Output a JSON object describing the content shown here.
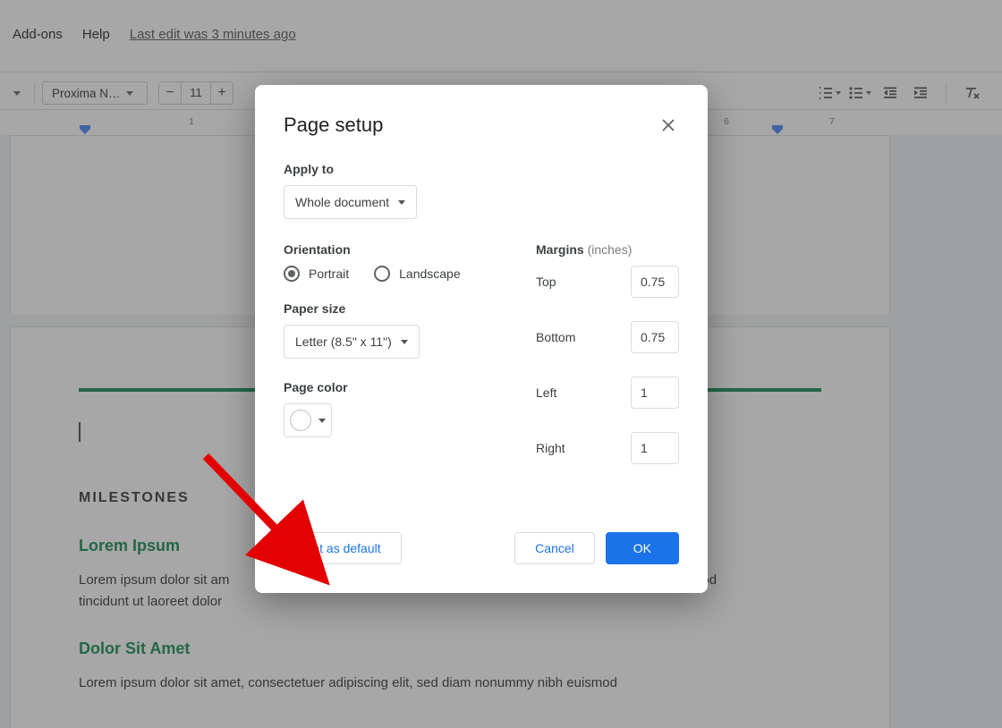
{
  "menu": {
    "addons": "Add-ons",
    "help": "Help",
    "lastEdit": "Last edit was 3 minutes ago"
  },
  "toolbar": {
    "fontName": "Proxima N…",
    "fontSize": "11"
  },
  "ruler": {
    "n1": "1",
    "n6": "6",
    "n7": "7"
  },
  "doc": {
    "milestones": "MILESTONES",
    "h1": "Lorem Ipsum",
    "p1a": "Lorem ipsum dolor sit am",
    "p1b": "od",
    "p2": "tincidunt ut laoreet dolor",
    "h2": "Dolor Sit Amet",
    "p3": "Lorem ipsum dolor sit amet, consectetuer adipiscing elit, sed diam nonummy nibh euismod"
  },
  "dlg": {
    "title": "Page setup",
    "applyToLabel": "Apply to",
    "applyToValue": "Whole document",
    "orientationLabel": "Orientation",
    "portrait": "Portrait",
    "landscape": "Landscape",
    "paperSizeLabel": "Paper size",
    "paperSizeValue": "Letter (8.5\" x 11\")",
    "pageColorLabel": "Page color",
    "marginsLabel": "Margins",
    "marginsUnit": "(inches)",
    "top": "Top",
    "bottom": "Bottom",
    "left": "Left",
    "right": "Right",
    "vTop": "0.75",
    "vBottom": "0.75",
    "vLeft": "1",
    "vRight": "1",
    "setDefault": "Set as default",
    "cancel": "Cancel",
    "ok": "OK"
  }
}
